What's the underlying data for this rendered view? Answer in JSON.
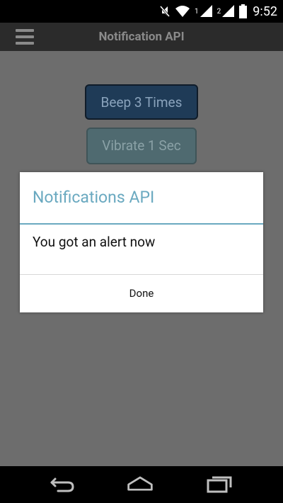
{
  "status_bar": {
    "time": "9:52",
    "sim1": "1",
    "sim2": "2",
    "icons": [
      "mute-icon",
      "wifi-icon",
      "signal-icon",
      "signal-icon",
      "battery-icon"
    ]
  },
  "app_bar": {
    "title": "Notification API",
    "menu_icon": "hamburger-menu-icon"
  },
  "buttons": {
    "beep": "Beep 3 Times",
    "vibrate": "Vibrate 1 Sec"
  },
  "dialog": {
    "title": "Notifications API",
    "message": "You got an alert now",
    "done": "Done"
  },
  "nav_bar": {
    "icons": [
      "back-icon",
      "home-icon",
      "recent-apps-icon"
    ]
  },
  "colors": {
    "dialog_accent": "#6aa9c0",
    "beep_button": "#1f3b57",
    "vibrate_button": "#4f6a70"
  }
}
